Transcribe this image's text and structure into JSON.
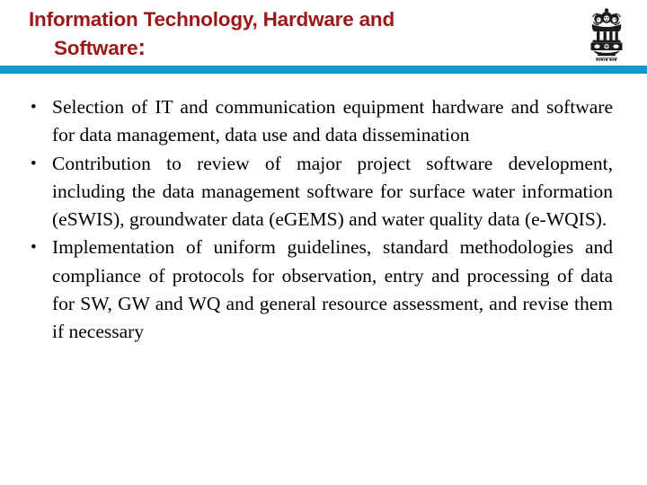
{
  "slide": {
    "background_color": "#ffffff",
    "accent_rule_color": "#1498CE",
    "title_color": "#9C1818",
    "body_color": "#000000"
  },
  "header": {
    "title_line_1": "Information Technology, Hardware and",
    "title_line_2": "Software",
    "title_colon": ":",
    "emblem": {
      "name": "national-emblem-of-india",
      "motto": "सत्यमेव जयते"
    }
  },
  "body": {
    "bullet_glyph": "•",
    "bullets": [
      {
        "id": "bullet-it-selection",
        "text": "Selection of IT and communication equipment hardware and software for data management, data use and data dissemination"
      },
      {
        "id": "bullet-review-contribution",
        "text": "Contribution to review of major project software development, including the data management software for surface water information (eSWIS), groundwater data (eGEMS) and water quality data (e-WQIS)."
      },
      {
        "id": "bullet-implementation-guidelines",
        "text": "Implementation of uniform guidelines, standard methodologies and compliance of protocols for observation, entry and processing of data for SW, GW and WQ and general resource assessment, and revise them if necessary"
      }
    ]
  }
}
